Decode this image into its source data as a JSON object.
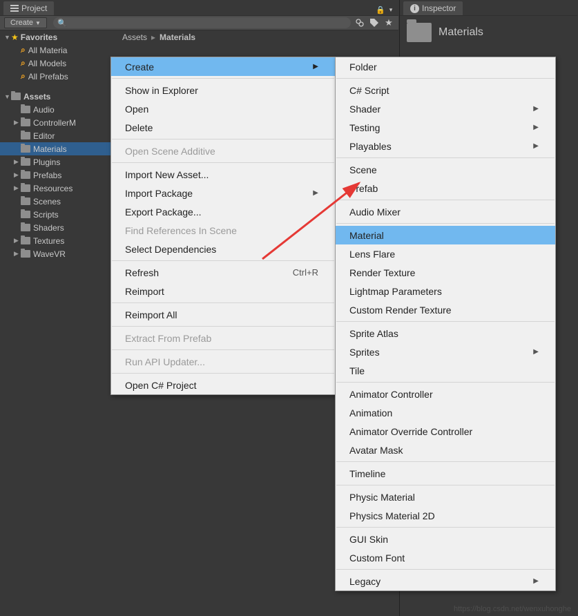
{
  "project": {
    "tab": "Project",
    "createBtn": "Create",
    "breadcrumb": {
      "root": "Assets",
      "current": "Materials"
    },
    "favorites": {
      "label": "Favorites",
      "items": [
        "All Materia",
        "All Models",
        "All Prefabs"
      ]
    },
    "assets": {
      "label": "Assets",
      "items": [
        {
          "name": "Audio",
          "hasFold": false
        },
        {
          "name": "ControllerM",
          "hasFold": true
        },
        {
          "name": "Editor",
          "hasFold": false
        },
        {
          "name": "Materials",
          "hasFold": false,
          "selected": true
        },
        {
          "name": "Plugins",
          "hasFold": true
        },
        {
          "name": "Prefabs",
          "hasFold": true
        },
        {
          "name": "Resources",
          "hasFold": true
        },
        {
          "name": "Scenes",
          "hasFold": false
        },
        {
          "name": "Scripts",
          "hasFold": false
        },
        {
          "name": "Shaders",
          "hasFold": false
        },
        {
          "name": "Textures",
          "hasFold": true
        },
        {
          "name": "WaveVR",
          "hasFold": true
        }
      ]
    }
  },
  "inspector": {
    "tab": "Inspector",
    "title": "Materials"
  },
  "contextMenu1": [
    {
      "label": "Create",
      "submenu": true,
      "highlighted": true
    },
    {
      "sep": true
    },
    {
      "label": "Show in Explorer"
    },
    {
      "label": "Open"
    },
    {
      "label": "Delete"
    },
    {
      "sep": true
    },
    {
      "label": "Open Scene Additive",
      "disabled": true
    },
    {
      "sep": true
    },
    {
      "label": "Import New Asset..."
    },
    {
      "label": "Import Package",
      "submenu": true
    },
    {
      "label": "Export Package..."
    },
    {
      "label": "Find References In Scene",
      "disabled": true
    },
    {
      "label": "Select Dependencies"
    },
    {
      "sep": true
    },
    {
      "label": "Refresh",
      "shortcut": "Ctrl+R"
    },
    {
      "label": "Reimport"
    },
    {
      "sep": true
    },
    {
      "label": "Reimport All"
    },
    {
      "sep": true
    },
    {
      "label": "Extract From Prefab",
      "disabled": true
    },
    {
      "sep": true
    },
    {
      "label": "Run API Updater...",
      "disabled": true
    },
    {
      "sep": true
    },
    {
      "label": "Open C# Project"
    }
  ],
  "contextMenu2": [
    {
      "label": "Folder"
    },
    {
      "sep": true
    },
    {
      "label": "C# Script"
    },
    {
      "label": "Shader",
      "submenu": true
    },
    {
      "label": "Testing",
      "submenu": true
    },
    {
      "label": "Playables",
      "submenu": true
    },
    {
      "sep": true
    },
    {
      "label": "Scene"
    },
    {
      "label": "Prefab"
    },
    {
      "sep": true
    },
    {
      "label": "Audio Mixer"
    },
    {
      "sep": true
    },
    {
      "label": "Material",
      "highlighted": true
    },
    {
      "label": "Lens Flare"
    },
    {
      "label": "Render Texture"
    },
    {
      "label": "Lightmap Parameters"
    },
    {
      "label": "Custom Render Texture"
    },
    {
      "sep": true
    },
    {
      "label": "Sprite Atlas"
    },
    {
      "label": "Sprites",
      "submenu": true
    },
    {
      "label": "Tile"
    },
    {
      "sep": true
    },
    {
      "label": "Animator Controller"
    },
    {
      "label": "Animation"
    },
    {
      "label": "Animator Override Controller"
    },
    {
      "label": "Avatar Mask"
    },
    {
      "sep": true
    },
    {
      "label": "Timeline"
    },
    {
      "sep": true
    },
    {
      "label": "Physic Material"
    },
    {
      "label": "Physics Material 2D"
    },
    {
      "sep": true
    },
    {
      "label": "GUI Skin"
    },
    {
      "label": "Custom Font"
    },
    {
      "sep": true
    },
    {
      "label": "Legacy",
      "submenu": true
    }
  ],
  "watermark": "https://blog.csdn.net/wenxuhonghe"
}
